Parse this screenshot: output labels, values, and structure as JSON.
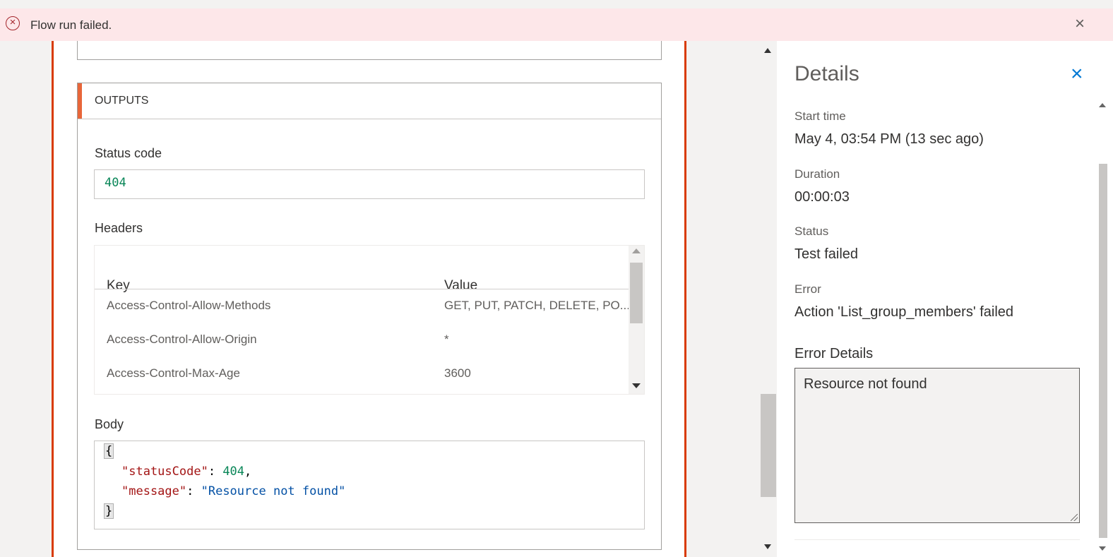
{
  "banner": {
    "message": "Flow run failed.",
    "icon": "error-circle-icon",
    "close_icon": "close-icon",
    "background": "#fde7e9"
  },
  "outputs": {
    "section_title": "OUTPUTS",
    "status_code_label": "Status code",
    "status_code_value": "404",
    "headers_label": "Headers",
    "headers_columns": [
      "Key",
      "Value"
    ],
    "headers_rows": [
      {
        "key": "Access-Control-Allow-Methods",
        "value": "GET, PUT, PATCH, DELETE, PO..."
      },
      {
        "key": "Access-Control-Allow-Origin",
        "value": "*"
      },
      {
        "key": "Access-Control-Max-Age",
        "value": "3600"
      }
    ],
    "body_label": "Body",
    "body_json": {
      "open": "{",
      "k1": "\"statusCode\"",
      "v1": "404",
      "k2": "\"message\"",
      "v2": "\"Resource not found\"",
      "close": "}"
    }
  },
  "details": {
    "title": "Details",
    "start_time_label": "Start time",
    "start_time_value": "May 4, 03:54 PM (13 sec ago)",
    "duration_label": "Duration",
    "duration_value": "00:00:03",
    "status_label": "Status",
    "status_value": "Test failed",
    "error_label": "Error",
    "error_value": "Action 'List_group_members' failed",
    "error_details_label": "Error Details",
    "error_details_value": "Resource not found"
  },
  "colors": {
    "error_accent": "#d83b01",
    "outputs_accent": "#e8663a",
    "link_blue": "#0078d4"
  }
}
